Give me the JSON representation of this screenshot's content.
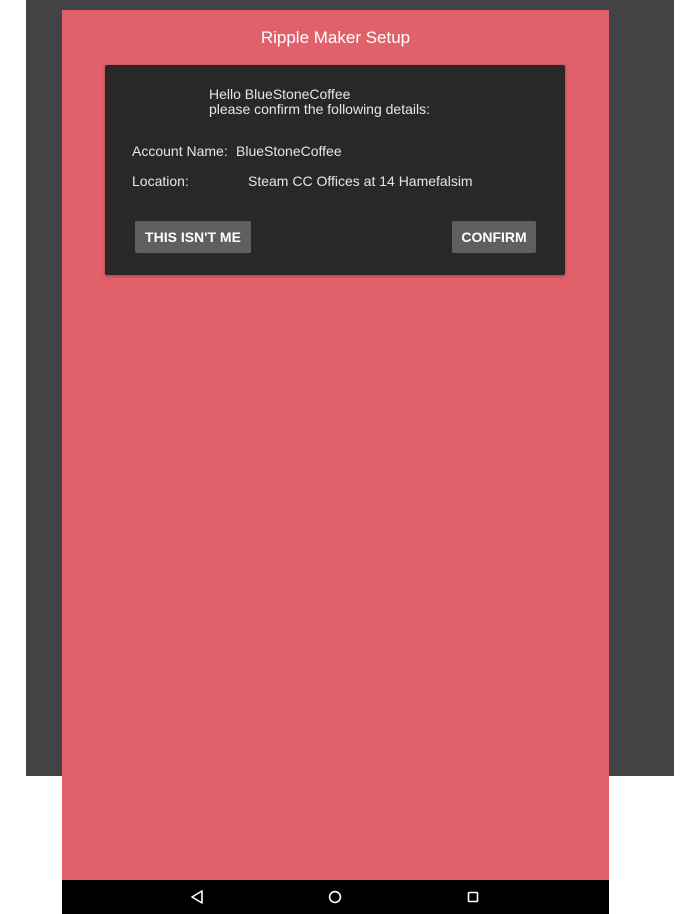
{
  "app": {
    "title": "Ripple Maker Setup"
  },
  "dialog": {
    "greeting_line1": "Hello BlueStoneCoffee",
    "greeting_line2": "please confirm the following details:",
    "account_label": "Account Name:",
    "account_value": "BlueStoneCoffee",
    "location_label": "Location:",
    "location_value": "Steam CC Offices at 14 Hamefalsim",
    "not_me_label": "THIS ISN'T ME",
    "confirm_label": "CONFIRM"
  },
  "navbar": {
    "icons": [
      "back-icon",
      "home-icon",
      "recents-icon"
    ]
  },
  "colors": {
    "screen_background": "#e0616a",
    "dialog_background": "#282828",
    "button_background": "#5f5f5f",
    "backdrop": "#434345",
    "navbar": "#000000"
  }
}
